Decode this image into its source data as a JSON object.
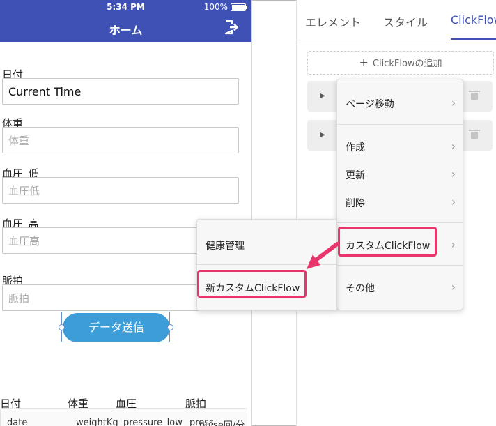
{
  "statusbar": {
    "time": "5:34 PM",
    "battery": "100%"
  },
  "navbar": {
    "title": "ホーム"
  },
  "form": {
    "date_label": "日付",
    "date_value": "Current Time",
    "weight_label": "体重",
    "weight_placeholder": "体重",
    "bp_low_label": "血圧_低",
    "bp_low_placeholder": "血圧低",
    "bp_high_label": "血圧_高",
    "bp_high_placeholder": "血圧高",
    "pulse_label": "脈拍",
    "pulse_placeholder": "脈拍",
    "submit_label": "データ送信"
  },
  "table": {
    "headers": [
      "日付",
      "体重",
      "血圧",
      "脈拍"
    ],
    "row": [
      "date",
      "weightKg",
      "pressure_low",
      "press",
      "pulse回/分"
    ]
  },
  "panel": {
    "tabs": [
      "エレメント",
      "スタイル",
      "ClickFlow"
    ],
    "active_tab": "ClickFlow",
    "add_flow_label": "ClickFlowの追加"
  },
  "menu_main": {
    "items": [
      "ページ移動",
      "作成",
      "更新",
      "削除",
      "カスタムClickFlow",
      "その他"
    ]
  },
  "menu_sub": {
    "items": [
      "健康管理",
      "新カスタムClickFlow"
    ]
  },
  "colors": {
    "header": "#3f51b5",
    "button": "#3d9dd9",
    "highlight": "#e8366d"
  }
}
